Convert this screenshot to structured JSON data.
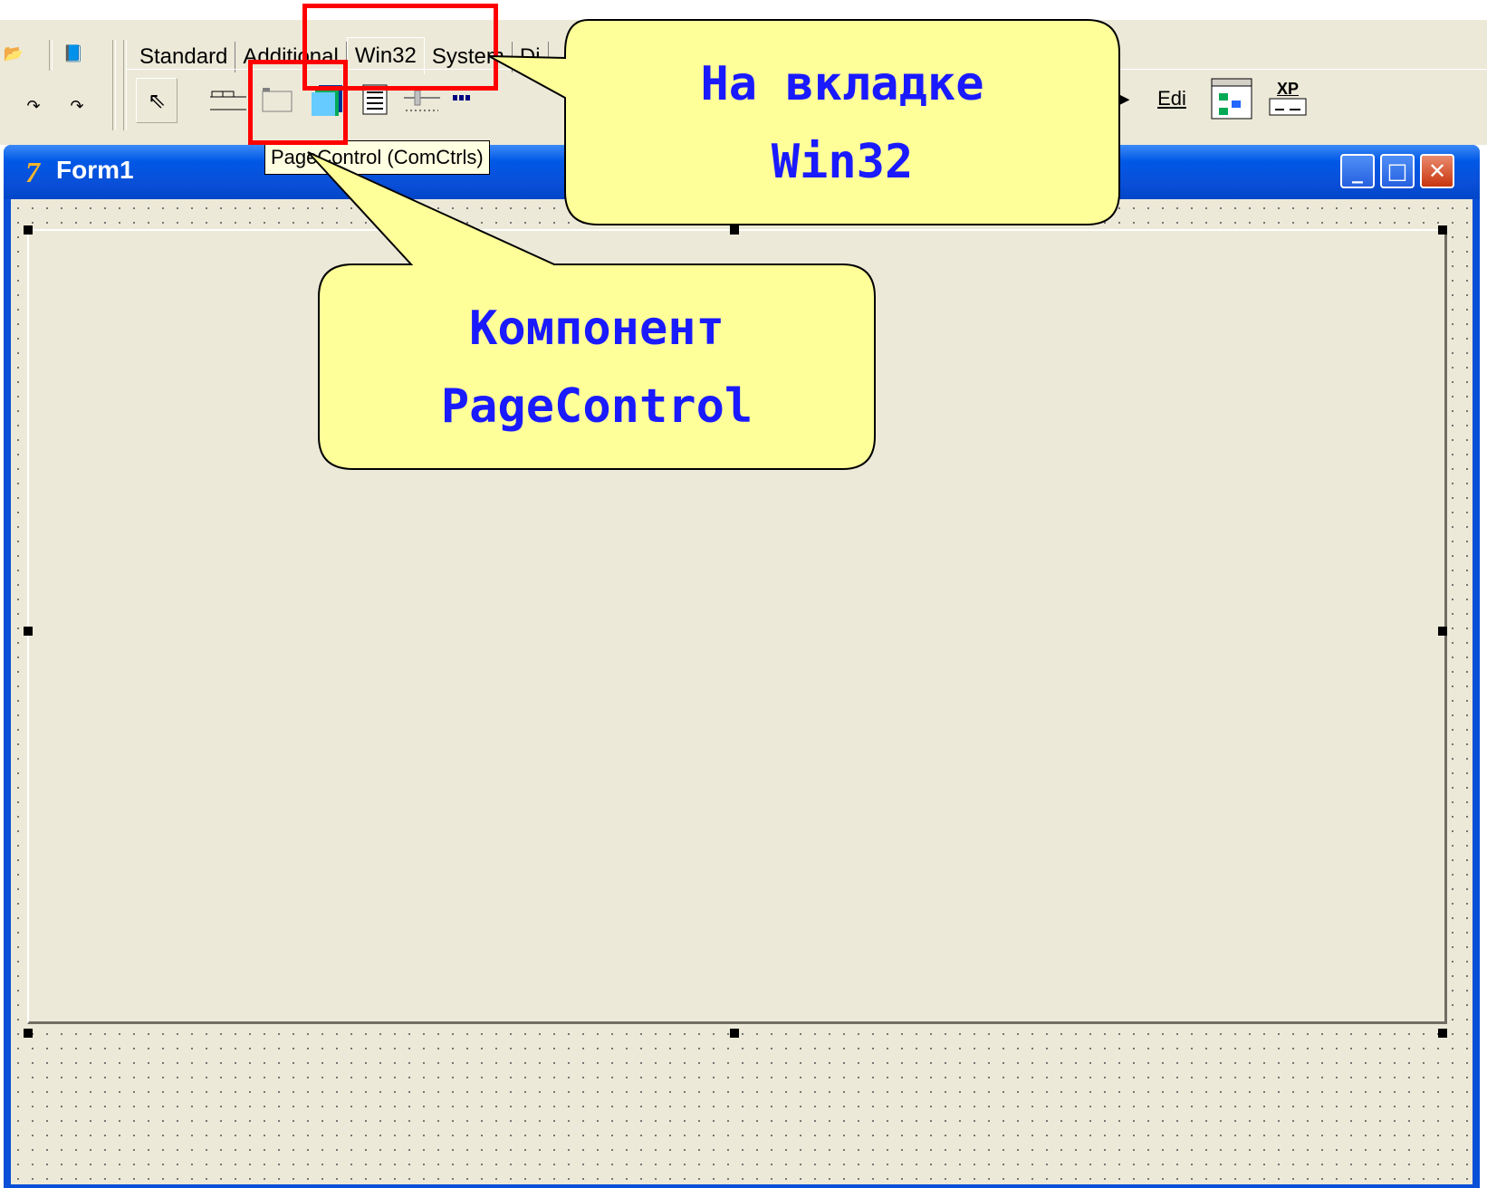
{
  "ide": {
    "palette_tabs": [
      "Standard",
      "Additional",
      "Win32",
      "System",
      "Di"
    ],
    "active_tab": "Win32",
    "palette_icons": [
      "pointer-icon",
      "tabcontrol-icon",
      "pagecontrol-icon",
      "imagelist-icon",
      "richedit-icon",
      "trackbar-icon",
      "progressbar-icon"
    ],
    "right_icons": {
      "scroll_right": "▸",
      "edit_label": "Edi",
      "xp_label": "XP"
    }
  },
  "tooltip": {
    "text": "PageControl (ComCtrls)"
  },
  "form": {
    "title": "Form1",
    "minimize": "_",
    "maximize": "□",
    "close": "✕"
  },
  "callouts": {
    "tab_hint_line1": "На вкладке",
    "tab_hint_line2": "Win32",
    "component_hint_line1": "Компонент",
    "component_hint_line2": "PageControl"
  },
  "colors": {
    "highlight": "#ff0000",
    "callout_fill": "#ffff99",
    "callout_text": "#1a1aff",
    "xp_titlebar": "#0a4fd8",
    "form_bg": "#ece9d8"
  }
}
